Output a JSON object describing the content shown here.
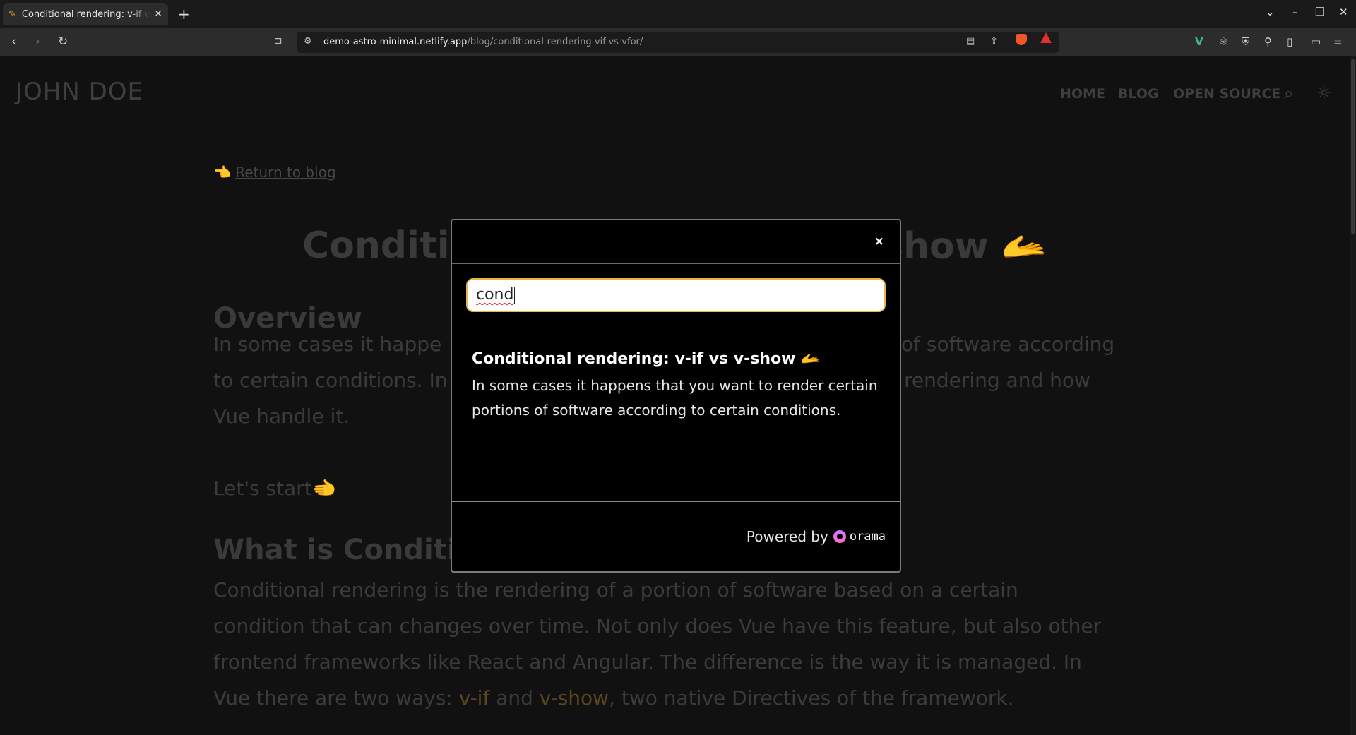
{
  "browser": {
    "tab": {
      "title": "Conditional rendering: v-if vs v-show",
      "favicon": "✎"
    },
    "url_host": "demo-astro-minimal.netlify.app",
    "url_path": "/blog/conditional-rendering-vif-vs-vfor/"
  },
  "site": {
    "brand": "JOHN DOE",
    "nav": [
      "HOME",
      "BLOG",
      "OPEN SOURCE"
    ],
    "back_link": "Return to blog",
    "back_icon": "👈",
    "post_title_left": "Conditio",
    "post_title_right": "show 🫴",
    "h2_overview": "Overview",
    "overview_lines": [
      "In some cases it happe",
      "to certain conditions. In",
      "Vue handle it."
    ],
    "overview_right_lines": [
      "of software according",
      "rendering and how"
    ],
    "lets_start": "Let's start🫲",
    "h2_what": "What is Conditio",
    "para_lines": [
      "Conditional rendering is the rendering of a portion of software based on a certain",
      "condition that can changes over time. Not only does Vue have this feature, but also other",
      "frontend frameworks like React and Angular. The difference is the way it is managed. In"
    ],
    "para_last": {
      "a": "Vue there are two ways: ",
      "vif": "v-if",
      "and": " and ",
      "vshow": "v-show",
      "rest": ", two native Directives of the framework."
    }
  },
  "modal": {
    "close_label": "×",
    "search_value": "cond",
    "result": {
      "title": "Conditional rendering: v-if vs v-show",
      "title_emoji": "🫴",
      "description": "In some cases it happens that you want to render certain portions of software according to certain conditions."
    },
    "powered_by": "Powered by",
    "brand": "orama"
  }
}
